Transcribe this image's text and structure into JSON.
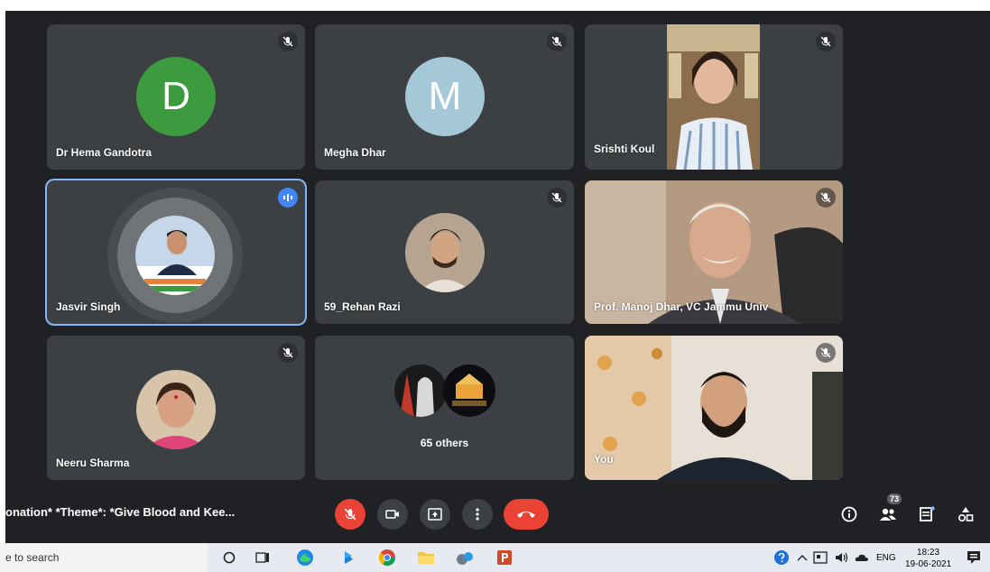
{
  "participants": [
    {
      "name": "Dr Hema Gandotra",
      "initial": "D",
      "avatar_color": "#3c9b3e",
      "muted": true
    },
    {
      "name": "Megha Dhar",
      "initial": "M",
      "avatar_color": "#a5c8d8",
      "muted": true
    },
    {
      "name": "Srishti Koul",
      "muted": true
    },
    {
      "name": "Jasvir Singh",
      "muted": false,
      "speaking": true
    },
    {
      "name": "59_Rehan Razi",
      "muted": true
    },
    {
      "name": "Prof. Manoj Dhar, VC Jammu Univ",
      "muted": true
    },
    {
      "name": "Neeru Sharma",
      "muted": true
    },
    {
      "name": "You",
      "muted": true
    }
  ],
  "others_label": "65 others",
  "meeting_title": "onation* *Theme*: *Give Blood and Kee...",
  "people_count": "73",
  "taskbar": {
    "search_placeholder": "e to search",
    "language": "ENG",
    "time": "18:23",
    "date": "19-06-2021"
  },
  "colors": {
    "background": "#202124",
    "tile": "#3c4043",
    "end_call": "#ea4335",
    "speaking_border": "#8ab4f8"
  }
}
